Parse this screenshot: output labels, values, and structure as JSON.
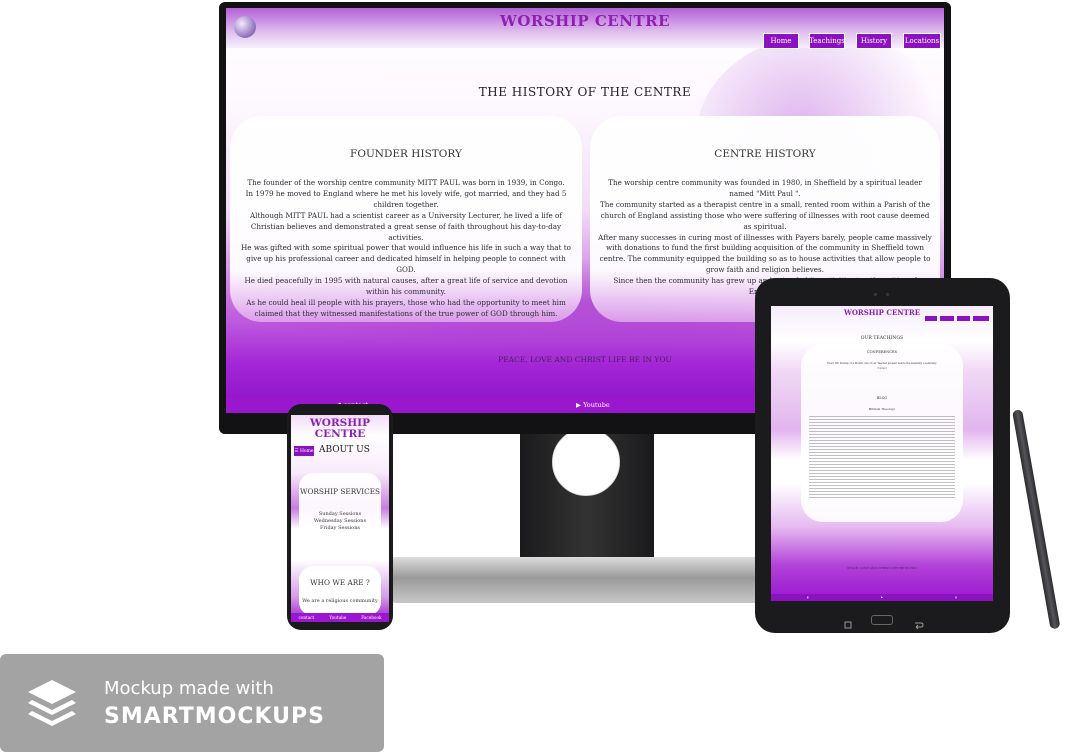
{
  "desktop": {
    "site_title": "WORSHIP CENTRE",
    "nav": [
      "Home",
      "Teachings",
      "History",
      "Locations"
    ],
    "page_title": "THE HISTORY OF THE CENTRE",
    "founder": {
      "title": "FOUNDER HISTORY",
      "lines": [
        "The founder of the worship centre community MITT PAUL was born in 1939, in Congo.",
        "In 1979 he moved to England where he met his lovely wife, got married, and they had 5 children together.",
        "Although MITT PAUL had a scientist career as a University Lecturer, he lived a life of Christian believes and demonstrated a great sense of faith throughout his day-to-day activities.",
        "He was gifted with some spiritual power that would influence his life in such a way that to give up his professional career and dedicated himself in helping people to connect with GOD.",
        "He died peacefully in 1995 with natural causes, after a great life of service and devotion within his community.",
        "As he could heal ill people with his prayers, those who had the opportunity to meet him claimed that they witnessed manifestations of the true power of GOD through him."
      ]
    },
    "centre": {
      "title": "CENTRE HISTORY",
      "lines": [
        "The worship centre community was founded in 1980, in Sheffield by a spiritual leader named \"Mitt Paul \".",
        "The community started as a therapist centre in a small, rented room within a Parish of the church of England assisting those who were suffering of illnesses with root cause deemed as spiritual.",
        "After many successes in curing most of illnesses with Payers barely, people came massively with donations to fund the first building acquisition of the community in Sheffield town centre. The community equipped the building so as to house activities that allow people to grow faith and religion believes.",
        "Since then the community has grew up and extended its activities to other cities of England."
      ]
    },
    "tagline": "PEACE, LOVE AND CHRIST LIFE BE IN YOU",
    "footer": {
      "contact": "contact",
      "youtube": "Youtube"
    }
  },
  "phone": {
    "site_title_1": "WORSHIP",
    "site_title_2": "CENTRE",
    "home_button": "Home",
    "about_title": "ABOUT US",
    "services_title": "WORSHIP SERVICES",
    "services": [
      "Sunday Sessions",
      "Wednesday Sessions",
      "Friday Sessions"
    ],
    "who_title": "WHO WE ARE ?",
    "who_text": "We are a religious community",
    "footer": [
      "contact",
      "Youtube",
      "Facebook"
    ]
  },
  "tablet": {
    "site_title": "WORSHIP CENTRE",
    "teachings_title": "OUR TEACHINGS",
    "conferences_title": "CONFERENCES",
    "conference_text": "Every 5th Sunday of a Month, one of our Teacher present before the assembly a summary.",
    "conference_link": "Contact",
    "blog_title": "BLOG",
    "blog_subtitle": "Biblical Theology",
    "tagline": "PEACE, LOVE AND CHRIST LIFE BE IN YOU"
  },
  "badge": {
    "line1": "Mockup made with",
    "line2": "SMARTMOCKUPS"
  },
  "colors": {
    "accent": "#8c12c0",
    "title": "#8e1fb5",
    "footer": "#9a17cf",
    "badge": "#a3a3a3"
  }
}
